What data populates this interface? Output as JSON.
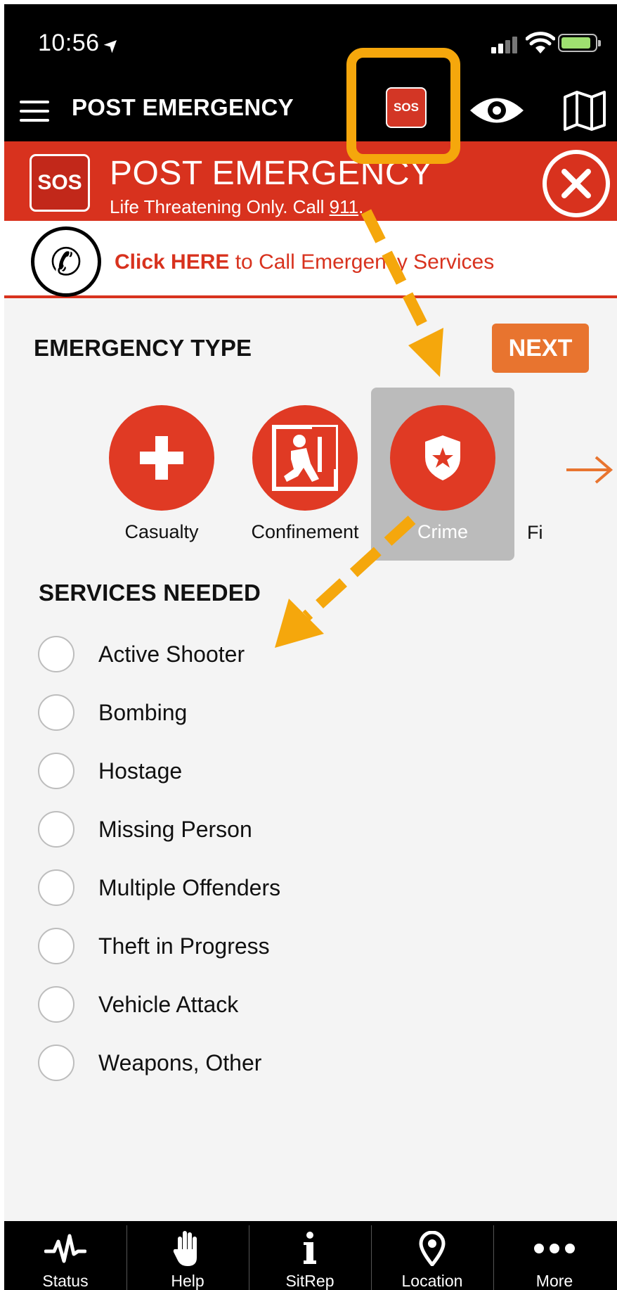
{
  "status_bar": {
    "time": "10:56"
  },
  "nav": {
    "title": "POST EMERGENCY",
    "sos_label": "SOS"
  },
  "banner": {
    "sos_label": "SOS",
    "title": "POST EMERGENCY",
    "subtitle_prefix": "Life Threatening Only. Call ",
    "subtitle_number": "911",
    "subtitle_suffix": "."
  },
  "call_bar": {
    "bold": "Click HERE",
    "rest": " to Call Emergency Services"
  },
  "emergency_type": {
    "title": "EMERGENCY TYPE",
    "next_label": "NEXT",
    "types": [
      {
        "label": "Casualty",
        "icon": "cross-icon"
      },
      {
        "label": "Confinement",
        "icon": "confinement-icon"
      },
      {
        "label": "Crime",
        "icon": "police-badge-icon",
        "selected": true
      }
    ],
    "partial_label": "Fi"
  },
  "services": {
    "title": "SERVICES NEEDED",
    "items": [
      "Active Shooter",
      "Bombing",
      "Hostage",
      "Missing Person",
      "Multiple Offenders",
      "Theft in Progress",
      "Vehicle Attack",
      "Weapons, Other"
    ]
  },
  "tabs": [
    {
      "label": "Status",
      "icon": "pulse-icon"
    },
    {
      "label": "Help",
      "icon": "hand-icon"
    },
    {
      "label": "SitRep",
      "icon": "info-icon"
    },
    {
      "label": "Location",
      "icon": "location-pin-icon"
    },
    {
      "label": "More",
      "icon": "more-dots-icon"
    }
  ],
  "colors": {
    "accent_red": "#d8321e",
    "next_orange": "#e8742f",
    "annotation_orange": "#f5a70c"
  }
}
